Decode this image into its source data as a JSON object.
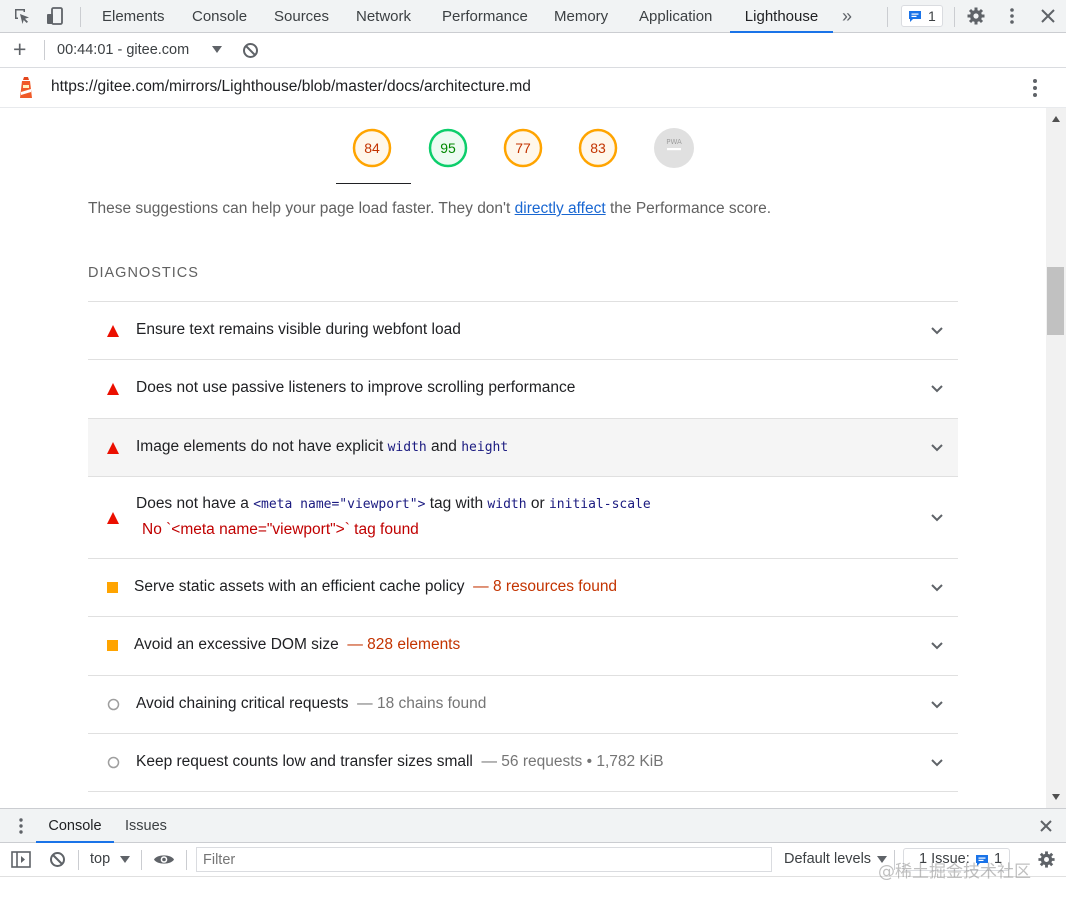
{
  "devtools": {
    "tabs": [
      "Elements",
      "Console",
      "Sources",
      "Network",
      "Performance",
      "Memory",
      "Application",
      "Lighthouse"
    ],
    "active_tab": "Lighthouse",
    "more_tabs": "»",
    "issues_count": "1"
  },
  "lighthouse_bar": {
    "add": "+",
    "report_selector": "00:44:01 - gitee.com"
  },
  "url": "https://gitee.com/mirrors/Lighthouse/blob/master/docs/architecture.md",
  "scores": [
    {
      "value": "84",
      "color": "#e67700",
      "ring": "#ffa400"
    },
    {
      "value": "95",
      "color": "#008800",
      "ring": "#0cce6b"
    },
    {
      "value": "77",
      "color": "#e67700",
      "ring": "#ffa400"
    },
    {
      "value": "83",
      "color": "#e67700",
      "ring": "#ffa400"
    },
    {
      "value": "PWA",
      "color": "#9e9e9e",
      "ring": "#e0e0e0"
    }
  ],
  "intro": {
    "before": "These suggestions can help your page load faster. They don't ",
    "link": "directly affect",
    "after": " the Performance score."
  },
  "section_title": "DIAGNOSTICS",
  "audits": {
    "a1": {
      "title": "Ensure text remains visible during webfont load"
    },
    "a2": {
      "title": "Does not use passive listeners to improve scrolling performance"
    },
    "a3": {
      "t1": "Image elements do not have explicit ",
      "c1": "width",
      "t2": " and ",
      "c2": "height"
    },
    "a4": {
      "t1": "Does not have a ",
      "c1": "<meta name=\"viewport\">",
      "t2": " tag with ",
      "c2": "width",
      "t3": " or ",
      "c3": "initial-scale",
      "error": "No `<meta name=\"viewport\">` tag found"
    },
    "a5": {
      "title": "Serve static assets with an efficient cache policy",
      "display": "— 8 resources found"
    },
    "a6": {
      "title": "Avoid an excessive DOM size",
      "display": "— 828 elements"
    },
    "a7": {
      "title": "Avoid chaining critical requests",
      "display": "— 18 chains found"
    },
    "a8": {
      "title": "Keep request counts low and transfer sizes small",
      "display": "— 56 requests • 1,782 KiB"
    }
  },
  "drawer": {
    "tabs": [
      "Console",
      "Issues"
    ],
    "context": "top",
    "filter_placeholder": "Filter",
    "levels": "Default levels",
    "issues": "1 Issue:",
    "issues_count": "1"
  },
  "watermark": "@稀土掘金技术社区"
}
